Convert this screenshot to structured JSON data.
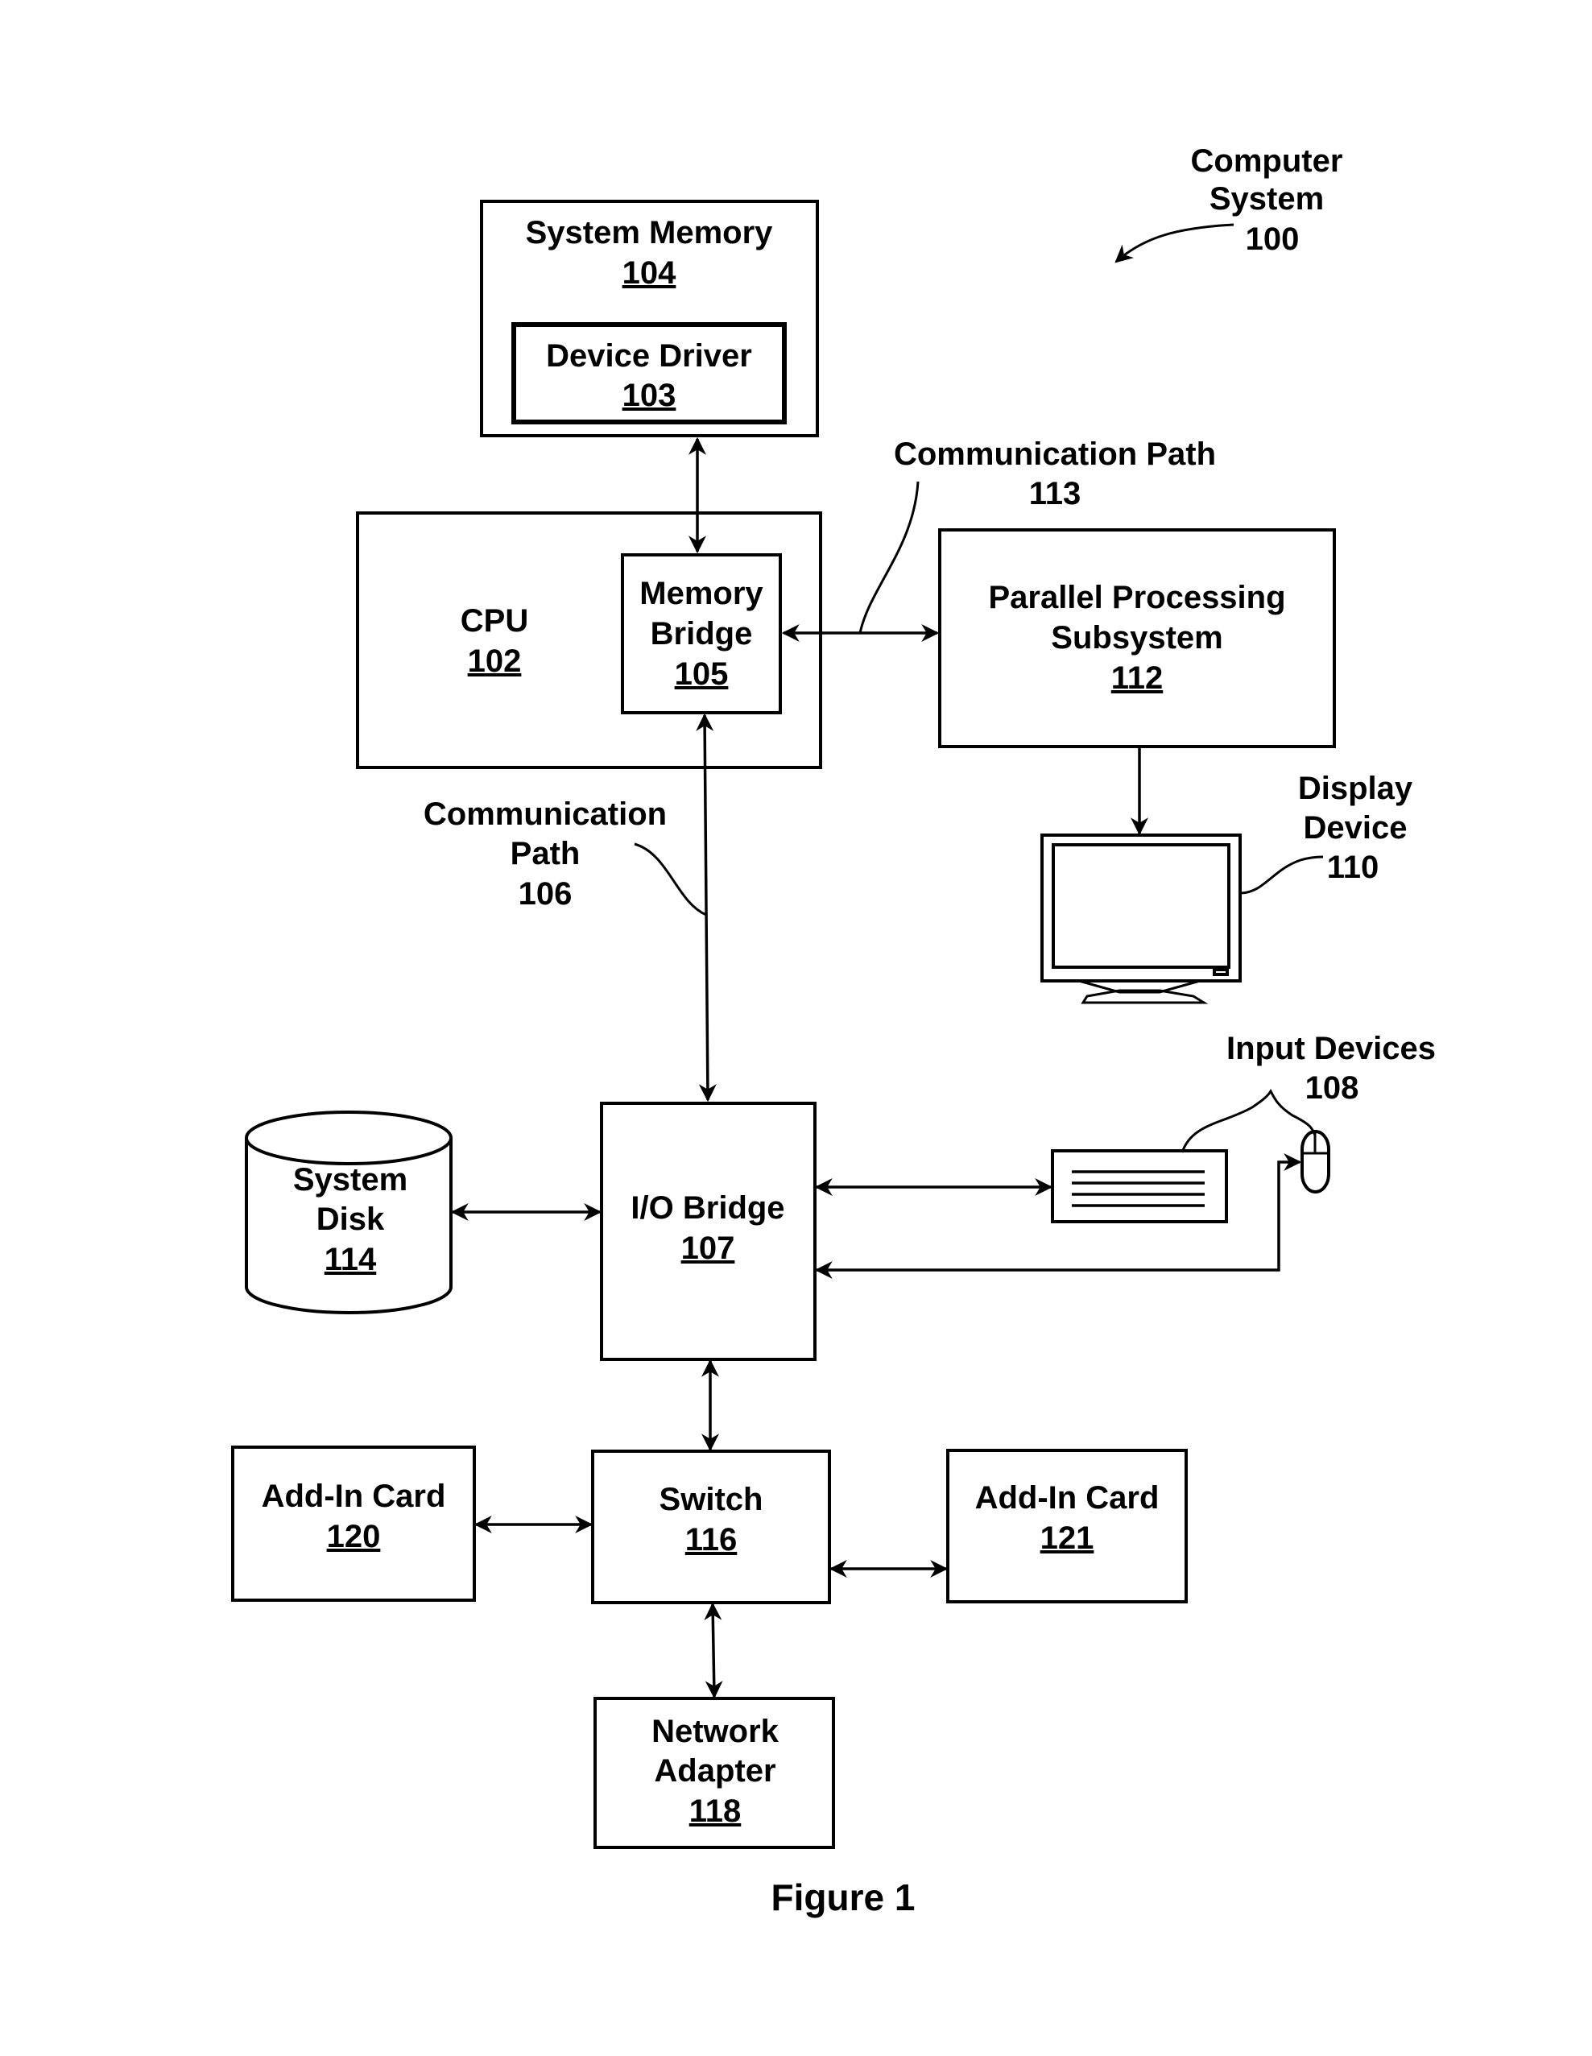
{
  "figure": {
    "title": "Computer System",
    "ref": "100",
    "caption": "Figure 1"
  },
  "components": {
    "system_memory": {
      "label": "System Memory",
      "ref": "104"
    },
    "device_driver": {
      "label": "Device Driver",
      "ref": "103"
    },
    "cpu": {
      "label": "CPU",
      "ref": "102"
    },
    "memory_bridge": {
      "label_line1": "Memory",
      "label_line2": "Bridge",
      "ref": "105"
    },
    "parallel_processing": {
      "label_line1": "Parallel Processing",
      "label_line2": "Subsystem",
      "ref": "112"
    },
    "display_device": {
      "label_line1": "Display",
      "label_line2": "Device",
      "ref": "110"
    },
    "input_devices": {
      "label": "Input Devices",
      "ref": "108"
    },
    "io_bridge": {
      "label": "I/O Bridge",
      "ref": "107"
    },
    "system_disk": {
      "label_line1": "System",
      "label_line2": "Disk",
      "ref": "114"
    },
    "switch": {
      "label": "Switch",
      "ref": "116"
    },
    "add_in_card_120": {
      "label": "Add-In Card",
      "ref": "120"
    },
    "add_in_card_121": {
      "label": "Add-In Card",
      "ref": "121"
    },
    "network_adapter": {
      "label_line1": "Network",
      "label_line2": "Adapter",
      "ref": "118"
    }
  },
  "paths": {
    "path_113": {
      "label": "Communication Path",
      "ref": "113"
    },
    "path_106": {
      "label_line1": "Communication",
      "label_line2": "Path",
      "ref": "106"
    }
  }
}
